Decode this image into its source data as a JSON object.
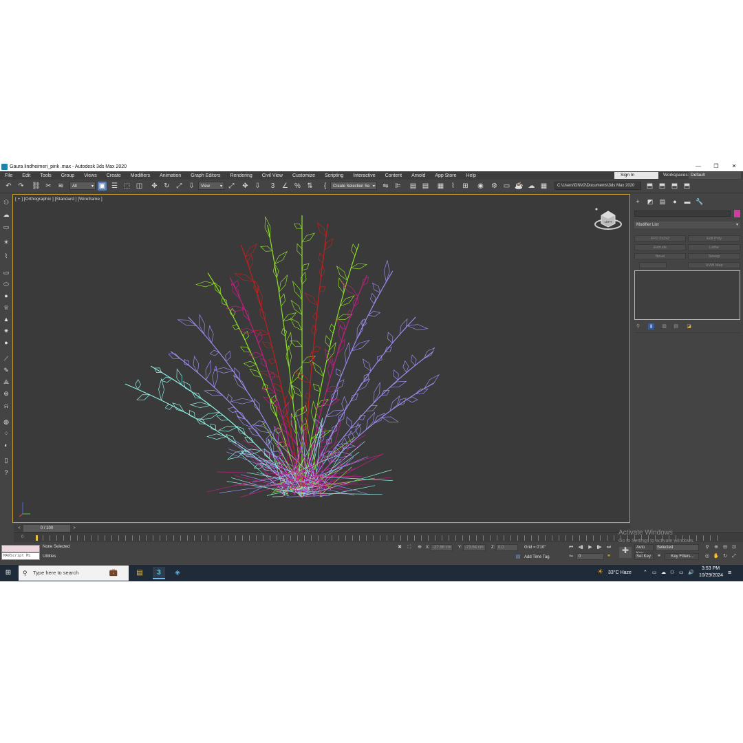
{
  "window": {
    "title": "Gaura lindheimeri_pink .max - Autodesk 3ds Max 2020",
    "controls": {
      "minimize": "—",
      "restore": "❐",
      "close": "✕"
    }
  },
  "menubar": {
    "items": [
      "File",
      "Edit",
      "Tools",
      "Group",
      "Views",
      "Create",
      "Modifiers",
      "Animation",
      "Graph Editors",
      "Rendering",
      "Civil View",
      "Customize",
      "Scripting",
      "Interactive",
      "Content",
      "Arnold",
      "App Store",
      "Help"
    ],
    "sign_in": "Sign In",
    "workspaces_label": "Workspaces:",
    "workspace_value": "Default"
  },
  "toolbar": {
    "filter_value": "All",
    "reference_coord": "View",
    "selection_set_placeholder": "Create Selection Se",
    "project_path": "C:\\Users\\DNV2\\Documents\\3ds Max 2020"
  },
  "viewport": {
    "label": "[ + ] [Orthographic ] [Standard ] [Wireframe ]",
    "viewcube_label": "LEFT",
    "active_border_color": "#c9a028",
    "colors": {
      "pink": "#c0207e",
      "red": "#c02020",
      "lime": "#8ee02a",
      "violet": "#9a8ef0",
      "cyan": "#8ef0e4",
      "magenta": "#b21e92"
    }
  },
  "command_panel": {
    "modifier_list": "Modifier List",
    "object_color": "#d23ca0",
    "modifier_buttons": [
      "FFD 2x2x2",
      "Edit Poly",
      "Extrude",
      "Lathe",
      "Bevel",
      "Sweep",
      "",
      "UVW Map"
    ]
  },
  "timeline": {
    "frame": "0 / 100",
    "prev": "<",
    "next": ">",
    "start_tick": "0"
  },
  "status": {
    "selection": "None Selected",
    "utilities": "Utilities",
    "maxscript": "MAXScript Mi",
    "x_label": "X:",
    "x_value": "-27.66 cm",
    "y_label": "Y:",
    "y_value": "-73.64 cm",
    "z_label": "Z:",
    "z_value": "0.0",
    "grid": "Grid = 0'10\"",
    "add_time_tag": "Add Time Tag",
    "auto_key": "Auto Key",
    "set_key": "Set Key",
    "key_mode": "Selected",
    "key_filters": "Key Filters...",
    "current_frame": "0",
    "activate_windows": "Activate Windows",
    "activate_windows_sub": "Go to Settings to activate Windows."
  },
  "taskbar": {
    "search_placeholder": "Type here to search",
    "weather": "33°C  Haze",
    "time": "3:53 PM",
    "date": "10/29/2024",
    "start_glyph": "⊞",
    "magnifier": "⚲"
  },
  "icons": {
    "undo": "↶",
    "redo": "↷",
    "link": "⛓",
    "unlink": "✂",
    "bind": "≋",
    "select": "▣",
    "select_by_name": "☰",
    "rect_region": "⬚",
    "window_crossing": "◫",
    "move": "✥",
    "rotate": "↻",
    "scale": "⤢",
    "place": "⇩",
    "snap": "3",
    "angle_snap": "∠",
    "percent_snap": "%",
    "spinner_snap": "⇅",
    "edit_named_sets": "{",
    "mirror": "⇋",
    "align": "⊫",
    "layers": "▤",
    "ribbon": "▦",
    "curve_editor": "⌇",
    "schematic": "⊞",
    "material_editor": "◉",
    "render_setup": "⚙",
    "rendered_frame": "▭",
    "render": "☕",
    "render_active": "☁",
    "open_project": "⬒",
    "user": "☺",
    "left_strip": [
      "⚇",
      "☁",
      "▭",
      "☀",
      "⌇",
      "▭",
      "⬭",
      "●",
      "♕",
      "▲",
      "✷",
      "●",
      "⟋",
      "✎",
      "⟁",
      "⊛",
      "⍾",
      "◍",
      "⁘",
      "◐",
      "▯",
      "?"
    ],
    "cmd_tabs": [
      "+",
      "◩",
      "▤",
      "●",
      "▬",
      "🔧"
    ],
    "stack_buttons": [
      "⚲",
      "▮",
      "▥",
      "▤",
      "◪"
    ],
    "status_lock": "✖",
    "status_abs": "⛶",
    "status_crosshair": "⊕",
    "status_tag": "▤",
    "key_plus": "✚",
    "key_tool": "⚭",
    "playback": [
      "⏮",
      "◂▮",
      "▶",
      "▮▸",
      "⏭"
    ],
    "nav": [
      "⚲",
      "⊕",
      "⊟",
      "⊡",
      "◎",
      "✋",
      "↻",
      "⤢"
    ],
    "task_explorer": "▤",
    "task_3dsmax": "3",
    "task_app": "◈",
    "task_briefcase": "💼",
    "tray": [
      "⌃",
      "▭",
      "☁",
      "⚇",
      "▭",
      "🔊",
      "≡"
    ]
  }
}
